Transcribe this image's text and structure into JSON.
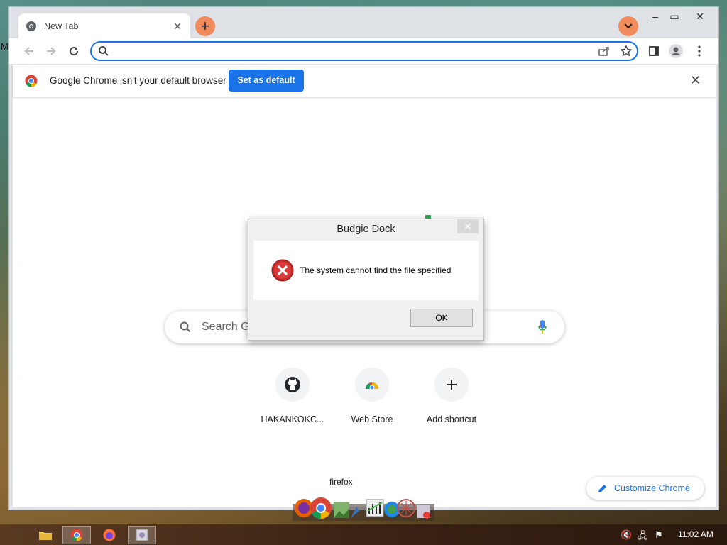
{
  "desktop": {
    "stray_text": "M"
  },
  "tab": {
    "title": "New Tab"
  },
  "toolbar": {
    "omnibox_value": ""
  },
  "infobar": {
    "message": "Google Chrome isn't your default browser",
    "button": "Set as default"
  },
  "ntp": {
    "search_placeholder": "Search Go",
    "shortcuts": [
      {
        "label": "HAKANKOKC...",
        "icon": "github-icon"
      },
      {
        "label": "Web Store",
        "icon": "webstore-icon"
      },
      {
        "label": "Add shortcut",
        "icon": "plus-icon"
      }
    ],
    "customize": "Customize Chrome"
  },
  "dialog": {
    "title": "Budgie Dock",
    "message": "The system cannot find the file specified",
    "ok": "OK"
  },
  "dock": {
    "hover_label": "firefox"
  },
  "taskbar": {
    "clock": "11:02 AM"
  },
  "colors": {
    "accent": "#1a73e8",
    "tab_button": "#f28b5c",
    "error": "#c62828"
  }
}
